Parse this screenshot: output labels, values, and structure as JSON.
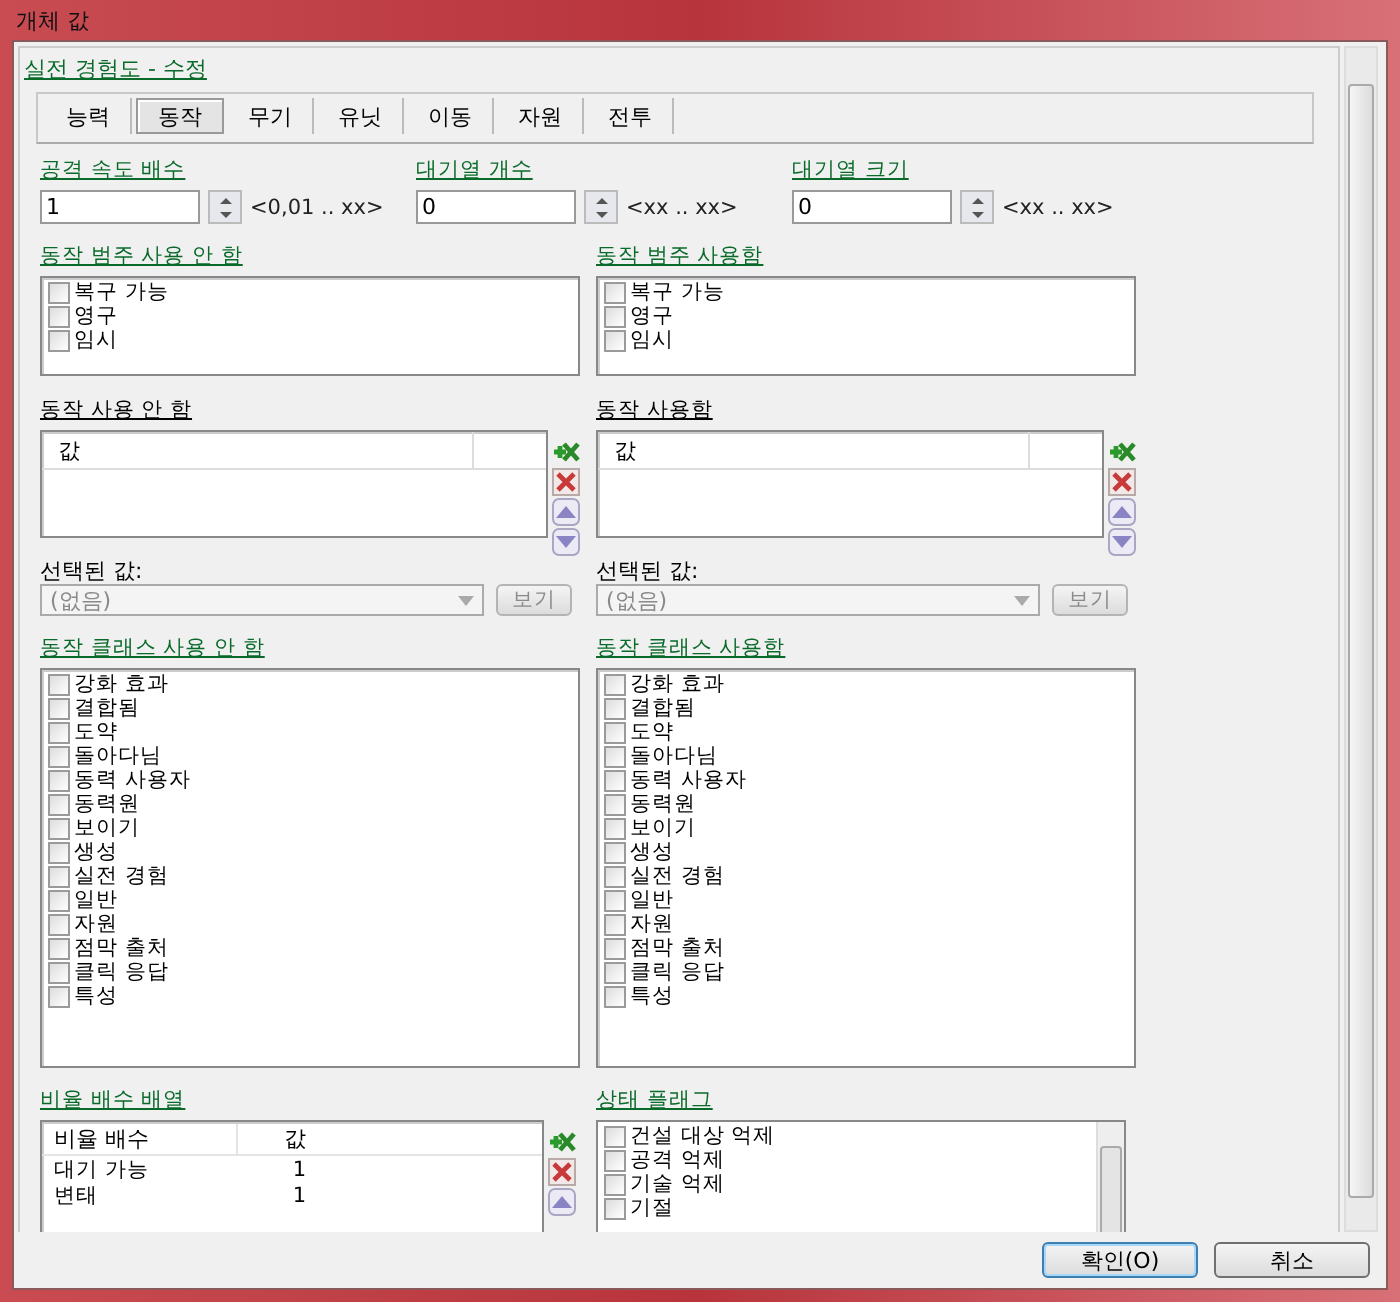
{
  "window": {
    "title": "개체 값"
  },
  "header_link": "실전 경험도 - 수정",
  "tabs": [
    {
      "label": "능력",
      "selected": false
    },
    {
      "label": "동작",
      "selected": true
    },
    {
      "label": "무기",
      "selected": false
    },
    {
      "label": "유닛",
      "selected": false
    },
    {
      "label": "이동",
      "selected": false
    },
    {
      "label": "자원",
      "selected": false
    },
    {
      "label": "전투",
      "selected": false
    }
  ],
  "spin_fields": [
    {
      "label": "공격 속도 배수",
      "value": "1",
      "range": "<0,01 .. xx>"
    },
    {
      "label": "대기열 개수",
      "value": "0",
      "range": "<xx .. xx>"
    },
    {
      "label": "대기열 크기",
      "value": "0",
      "range": "<xx .. xx>"
    }
  ],
  "category_lists": [
    {
      "label": "동작 범주 사용 안 함",
      "items": [
        {
          "label": "복구 가능",
          "checked": false
        },
        {
          "label": "영구",
          "checked": false
        },
        {
          "label": "임시",
          "checked": false
        }
      ]
    },
    {
      "label": "동작 범주 사용함",
      "items": [
        {
          "label": "복구 가능",
          "checked": false
        },
        {
          "label": "영구",
          "checked": false
        },
        {
          "label": "임시",
          "checked": false
        }
      ]
    }
  ],
  "value_lists": [
    {
      "label": "동작 사용 안 함",
      "column": "값",
      "selected_label": "선택된 값:",
      "dropdown": {
        "value": "(없음)",
        "disabled": true
      },
      "view_button": {
        "label": "보기",
        "disabled": true
      }
    },
    {
      "label": "동작 사용함",
      "column": "값",
      "selected_label": "선택된 값:",
      "dropdown": {
        "value": "(없음)",
        "disabled": true
      },
      "view_button": {
        "label": "보기",
        "disabled": true
      }
    }
  ],
  "class_lists": [
    {
      "label": "동작 클래스 사용 안 함",
      "items": [
        {
          "label": "강화 효과",
          "checked": false
        },
        {
          "label": "결합됨",
          "checked": false
        },
        {
          "label": "도약",
          "checked": false
        },
        {
          "label": "돌아다님",
          "checked": false
        },
        {
          "label": "동력 사용자",
          "checked": false
        },
        {
          "label": "동력원",
          "checked": false
        },
        {
          "label": "보이기",
          "checked": false
        },
        {
          "label": "생성",
          "checked": false
        },
        {
          "label": "실전 경험",
          "checked": false
        },
        {
          "label": "일반",
          "checked": false
        },
        {
          "label": "자원",
          "checked": false
        },
        {
          "label": "점막 출처",
          "checked": false
        },
        {
          "label": "클릭 응답",
          "checked": false
        },
        {
          "label": "특성",
          "checked": false
        }
      ]
    },
    {
      "label": "동작 클래스 사용함",
      "items": [
        {
          "label": "강화 효과",
          "checked": false
        },
        {
          "label": "결합됨",
          "checked": false
        },
        {
          "label": "도약",
          "checked": false
        },
        {
          "label": "돌아다님",
          "checked": false
        },
        {
          "label": "동력 사용자",
          "checked": false
        },
        {
          "label": "동력원",
          "checked": false
        },
        {
          "label": "보이기",
          "checked": false
        },
        {
          "label": "생성",
          "checked": false
        },
        {
          "label": "실전 경험",
          "checked": false
        },
        {
          "label": "일반",
          "checked": false
        },
        {
          "label": "자원",
          "checked": false
        },
        {
          "label": "점막 출처",
          "checked": false
        },
        {
          "label": "클릭 응답",
          "checked": false
        },
        {
          "label": "특성",
          "checked": false
        }
      ]
    }
  ],
  "ratio_table": {
    "label": "비율 배수 배열",
    "columns": [
      "비율 배수",
      "값"
    ],
    "rows": [
      [
        "대기 가능",
        "1"
      ],
      [
        "변태",
        "1"
      ]
    ]
  },
  "state_flags": {
    "label": "상태 플래그",
    "items": [
      {
        "label": "건설 대상 억제",
        "checked": false
      },
      {
        "label": "공격 억제",
        "checked": false
      },
      {
        "label": "기술 억제",
        "checked": false
      },
      {
        "label": "기절",
        "checked": false
      }
    ]
  },
  "buttons": [
    {
      "label": "확인(O)",
      "default": true
    },
    {
      "label": "취소",
      "default": false
    }
  ]
}
